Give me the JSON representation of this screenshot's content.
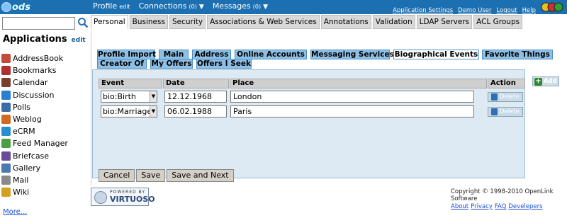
{
  "brand": {
    "logo_text": "ods"
  },
  "topnav": {
    "profile": {
      "label": "Profile",
      "sub": "edit"
    },
    "connections": {
      "label": "Connections",
      "count": "(0)"
    },
    "messages": {
      "label": "Messages",
      "count": "(0)"
    }
  },
  "toplinks": [
    "Application Settings",
    "Demo User",
    "Logout",
    "Help"
  ],
  "search": {
    "value": "",
    "placeholder": ""
  },
  "sidebar": {
    "title": "Applications",
    "edit": "edit",
    "items": [
      {
        "label": "AddressBook",
        "icon": "addressbook-icon",
        "color": "#c44a3a"
      },
      {
        "label": "Bookmarks",
        "icon": "bookmarks-icon",
        "color": "#b03030"
      },
      {
        "label": "Calendar",
        "icon": "calendar-icon",
        "color": "#7a3f2a"
      },
      {
        "label": "Discussion",
        "icon": "discussion-icon",
        "color": "#2a7fd0"
      },
      {
        "label": "Polls",
        "icon": "polls-icon",
        "color": "#3a6ea5"
      },
      {
        "label": "Weblog",
        "icon": "weblog-icon",
        "color": "#d06a20"
      },
      {
        "label": "eCRM",
        "icon": "ecrm-icon",
        "color": "#2a8fd0"
      },
      {
        "label": "Feed Manager",
        "icon": "feed-icon",
        "color": "#4aa040"
      },
      {
        "label": "Briefcase",
        "icon": "briefcase-icon",
        "color": "#6a4a9a"
      },
      {
        "label": "Gallery",
        "icon": "gallery-icon",
        "color": "#4a7ab0"
      },
      {
        "label": "Mail",
        "icon": "mail-icon",
        "color": "#8a8a8a"
      },
      {
        "label": "Wiki",
        "icon": "wiki-icon",
        "color": "#d4a020"
      }
    ],
    "more": "More..."
  },
  "main_tabs": [
    {
      "label": "Personal",
      "active": true
    },
    {
      "label": "Business",
      "active": false
    },
    {
      "label": "Security",
      "active": false
    },
    {
      "label": "Associations & Web Services",
      "active": false
    },
    {
      "label": "Annotations",
      "active": false
    },
    {
      "label": "Validation",
      "active": false
    },
    {
      "label": "LDAP Servers",
      "active": false
    },
    {
      "label": "ACL Groups",
      "active": false
    }
  ],
  "inner_tabs_row1": [
    {
      "label": "Profile Import",
      "active": false
    },
    {
      "label": "Main",
      "active": false
    },
    {
      "label": "Address",
      "active": false
    },
    {
      "label": "Online Accounts",
      "active": false
    },
    {
      "label": "Messaging Services",
      "active": false
    },
    {
      "label": "Biographical Events",
      "active": true
    },
    {
      "label": "Favorite Things",
      "active": false
    }
  ],
  "inner_tabs_row2": [
    {
      "label": "Creator Of",
      "active": false
    },
    {
      "label": "My Offers",
      "active": false
    },
    {
      "label": "Offers I Seek",
      "active": false
    }
  ],
  "grid": {
    "headers": {
      "event": "Event",
      "date": "Date",
      "place": "Place",
      "action": "Action"
    },
    "rows": [
      {
        "event": "bio:Birth",
        "date": "12.12.1968",
        "place": "London",
        "action": "Delete"
      },
      {
        "event": "bio:Marriage",
        "date": "06.02.1988",
        "place": "Paris",
        "action": "Delete"
      }
    ],
    "add_label": "Add"
  },
  "buttons": {
    "cancel": "Cancel",
    "save": "Save",
    "save_next": "Save and Next"
  },
  "footer": {
    "powered_by": "POWERED BY",
    "virtuoso": "VIRTUOSO",
    "copyright": "Copyright © 1998-2010 OpenLink Software",
    "links": [
      "About",
      "Privacy",
      "FAQ",
      "Develepers"
    ]
  }
}
